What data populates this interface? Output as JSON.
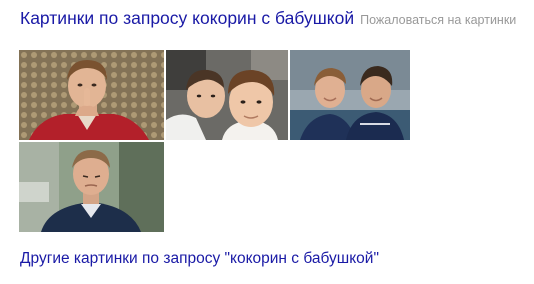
{
  "header": {
    "title": "Картинки по запросу кокорин с бабушкой",
    "complain": "Пожаловаться на картинки"
  },
  "thumbnails": [
    {
      "id": "t1"
    },
    {
      "id": "t2"
    },
    {
      "id": "t3"
    },
    {
      "id": "t4"
    }
  ],
  "footer": {
    "more_link": "Другие картинки по запросу \"кокорин с бабушкой\""
  },
  "colors": {
    "link": "#1a1aa6",
    "muted": "#999999",
    "background": "#ffffff"
  }
}
